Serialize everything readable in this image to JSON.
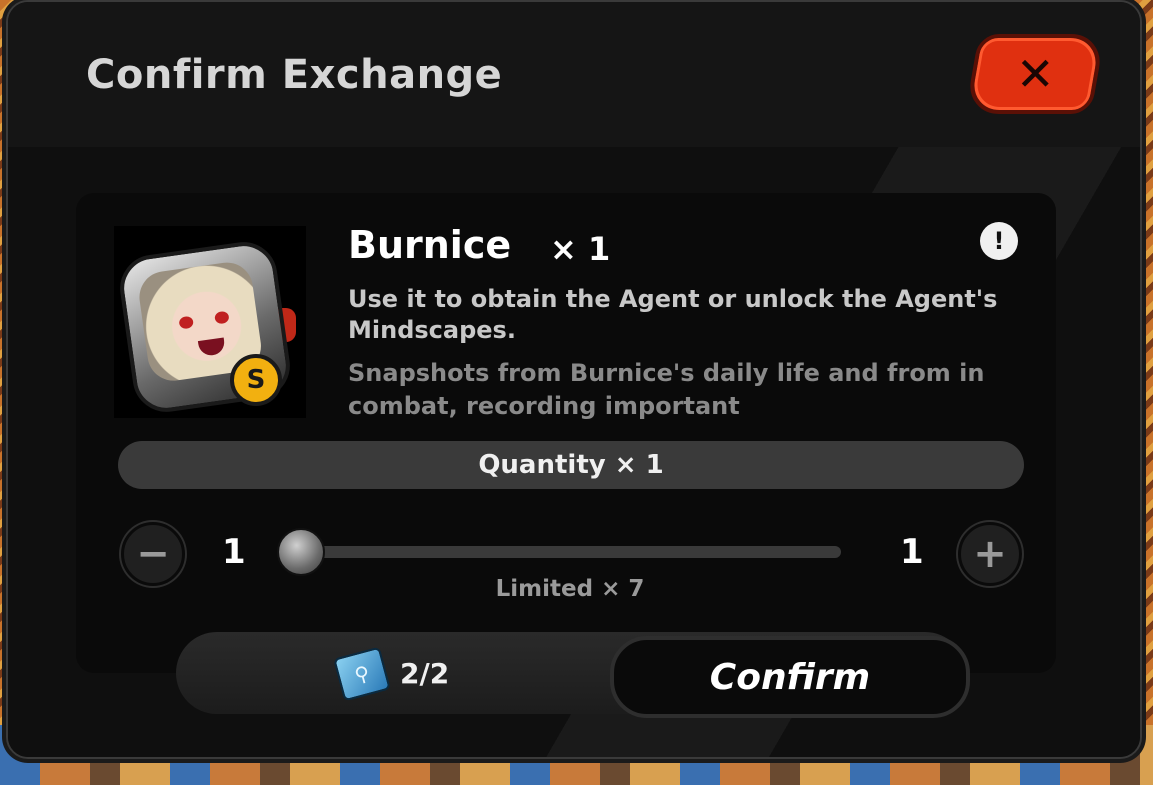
{
  "dialog": {
    "title": "Confirm Exchange",
    "close_label": "✕"
  },
  "item": {
    "name": "Burnice",
    "count": "× 1",
    "rank_badge": "S",
    "info_icon_glyph": "!",
    "description": "Use it to obtain the Agent or unlock the Agent's Mindscapes.",
    "flavor_text": "Snapshots from Burnice's daily life and from in combat, recording important"
  },
  "quantity": {
    "label": "Quantity × 1",
    "min": "1",
    "max": "1",
    "value": 1,
    "minus_label": "−",
    "plus_label": "+",
    "limit_label": "Limited × 7"
  },
  "footer": {
    "cost_icon": "ticket-icon",
    "cost_icon_glyph": "⚲",
    "cost_text": "2/2",
    "confirm_label": "Confirm"
  },
  "colors": {
    "close_button": "#e03010",
    "rank_badge": "#f2b010"
  }
}
